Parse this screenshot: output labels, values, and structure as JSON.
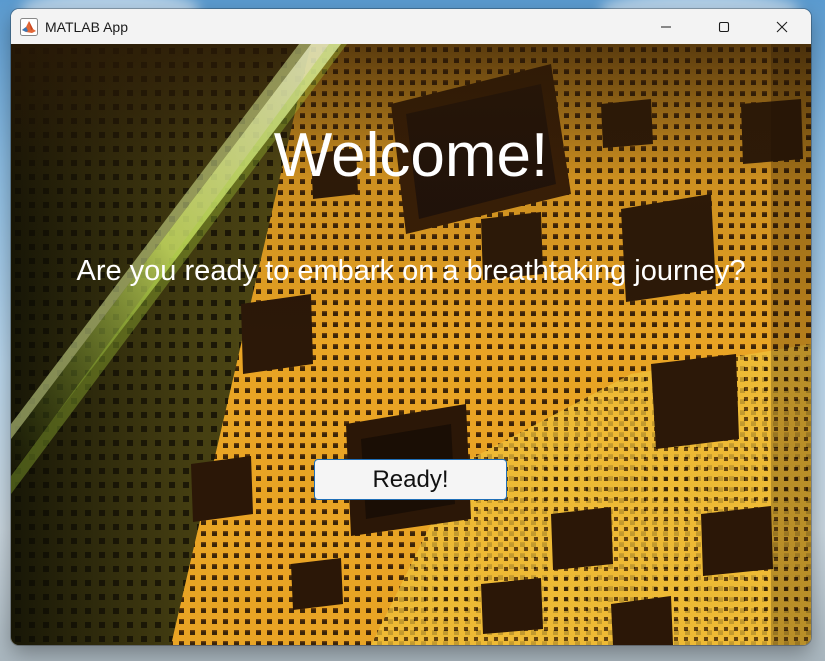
{
  "window": {
    "title": "MATLAB App",
    "app_icon": "matlab-membrane-icon",
    "controls": {
      "minimize_icon": "minimize-icon",
      "maximize_icon": "maximize-icon",
      "close_icon": "close-icon"
    }
  },
  "main": {
    "heading": "Welcome!",
    "subtitle": "Are you ready to embark on a breathtaking journey?",
    "ready_button_label": "Ready!",
    "background_image": "menger-sponge-fractal"
  },
  "colors": {
    "fractal_orange": "#e9a424",
    "fractal_shadow": "#2e1a08",
    "button_border": "#1f6fb8",
    "text": "#ffffff"
  }
}
